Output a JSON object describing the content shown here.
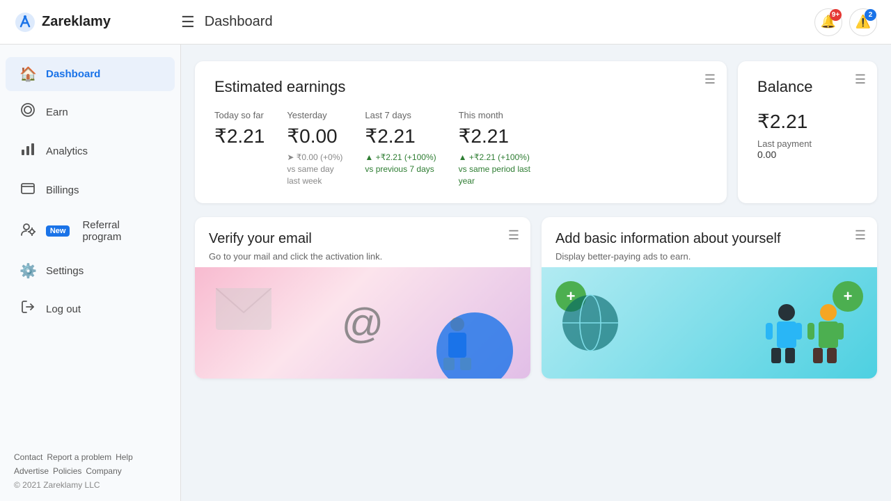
{
  "app": {
    "name": "Zareklamy",
    "page_title": "Dashboard"
  },
  "topbar": {
    "hamburger": "☰",
    "bell_badge": "9+",
    "alert_badge": "2"
  },
  "sidebar": {
    "items": [
      {
        "id": "dashboard",
        "label": "Dashboard",
        "icon": "🏠",
        "active": true
      },
      {
        "id": "earn",
        "label": "Earn",
        "icon": "⭕",
        "active": false
      },
      {
        "id": "analytics",
        "label": "Analytics",
        "icon": "📊",
        "active": false
      },
      {
        "id": "billings",
        "label": "Billings",
        "icon": "🪪",
        "active": false
      },
      {
        "id": "referral",
        "label": "Referral program",
        "icon": "👤+",
        "active": false,
        "new": true
      },
      {
        "id": "settings",
        "label": "Settings",
        "icon": "⚙️",
        "active": false
      },
      {
        "id": "logout",
        "label": "Log out",
        "icon": "↗",
        "active": false
      }
    ],
    "footer_links": [
      "Contact",
      "Report a problem",
      "Help",
      "Advertise",
      "Policies",
      "Company"
    ],
    "copyright": "© 2021 Zareklamy LLC"
  },
  "earnings_card": {
    "title": "Estimated earnings",
    "columns": [
      {
        "label": "Today so far",
        "value": "₹2.21",
        "change": "",
        "change_type": "neutral"
      },
      {
        "label": "Yesterday",
        "value": "₹0.00",
        "change": "➤ ₹0.00 (+0%)\nvs same day\nlast week",
        "change_type": "neutral"
      },
      {
        "label": "Last 7 days",
        "value": "₹2.21",
        "change": "▲ +₹2.21 (+100%)\nvs previous 7 days",
        "change_type": "up"
      },
      {
        "label": "This month",
        "value": "₹2.21",
        "change": "▲ +₹2.21 (+100%)\nvs same period last\nyear",
        "change_type": "up"
      }
    ]
  },
  "balance_card": {
    "title": "Balance",
    "amount": "₹2.21",
    "last_payment_label": "Last payment",
    "last_payment_value": "0.00"
  },
  "action_cards": [
    {
      "id": "verify-email",
      "title": "Verify your email",
      "description": "Go to your mail and click the activation link."
    },
    {
      "id": "add-info",
      "title": "Add basic information about yourself",
      "description": "Display better-paying ads to earn."
    }
  ],
  "new_badge_label": "New"
}
